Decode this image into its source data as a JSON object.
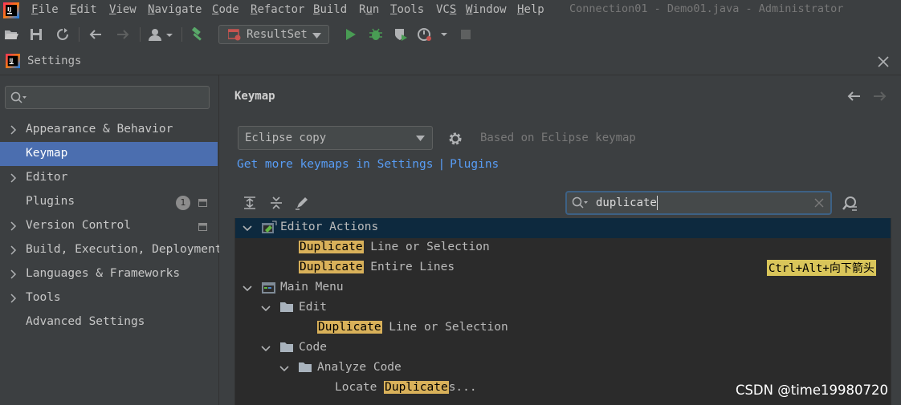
{
  "menubar": {
    "items": [
      {
        "label": "File",
        "mnemonic": "F",
        "rest": "ile"
      },
      {
        "label": "Edit",
        "mnemonic": "E",
        "rest": "dit"
      },
      {
        "label": "View",
        "mnemonic": "V",
        "rest": "iew"
      },
      {
        "label": "Navigate",
        "mnemonic": "N",
        "rest": "avigate"
      },
      {
        "label": "Code",
        "mnemonic": "C",
        "rest": "ode"
      },
      {
        "label": "Refactor",
        "mnemonic": "R",
        "rest": "efactor"
      },
      {
        "label": "Build",
        "mnemonic": "B",
        "rest": "uild"
      },
      {
        "label": "Run",
        "mnemonic": "R",
        "rest": "un",
        "underline_index": 1
      },
      {
        "label": "Tools",
        "mnemonic": "T",
        "rest": "ools"
      },
      {
        "label": "VCS",
        "mnemonic": "S",
        "rest": "VC",
        "underline_index": 2
      },
      {
        "label": "Window",
        "mnemonic": "W",
        "rest": "indow"
      },
      {
        "label": "Help",
        "mnemonic": "H",
        "rest": "elp"
      }
    ],
    "window_title": "Connection01 - Demo01.java - Administrator"
  },
  "toolbar": {
    "run_config": "ResultSet",
    "icons": [
      "open-icon",
      "save-icon",
      "sync-icon",
      "back-icon",
      "forward-icon",
      "user-icon",
      "build-hammer-icon",
      "run-icon",
      "debug-icon",
      "coverage-icon",
      "profile-icon",
      "stop-icon"
    ]
  },
  "dialog": {
    "title": "Settings",
    "sidebar": {
      "search_placeholder": "",
      "items": [
        {
          "label": "Appearance & Behavior",
          "expandable": true,
          "selected": false
        },
        {
          "label": "Keymap",
          "expandable": false,
          "selected": true
        },
        {
          "label": "Editor",
          "expandable": true,
          "selected": false
        },
        {
          "label": "Plugins",
          "expandable": false,
          "selected": false,
          "badge": "1"
        },
        {
          "label": "Version Control",
          "expandable": true,
          "selected": false
        },
        {
          "label": "Build, Execution, Deployment",
          "expandable": true,
          "selected": false
        },
        {
          "label": "Languages & Frameworks",
          "expandable": true,
          "selected": false
        },
        {
          "label": "Tools",
          "expandable": true,
          "selected": false
        },
        {
          "label": "Advanced Settings",
          "expandable": false,
          "selected": false
        }
      ]
    },
    "main": {
      "title": "Keymap",
      "keymap_selected": "Eclipse copy",
      "based_on": "Based on Eclipse keymap",
      "link_get_more": "Get more keymaps in Settings",
      "link_separator": "|",
      "link_plugins": "Plugins",
      "search_value": "duplicate",
      "tree": [
        {
          "depth": 0,
          "expanded": true,
          "icon": "editor-actions-icon",
          "text": "Editor Actions",
          "selected": true
        },
        {
          "depth": 2,
          "hl": "Duplicate",
          "text": " Line or Selection"
        },
        {
          "depth": 2,
          "hl": "Duplicate",
          "text": " Entire Lines",
          "shortcut": "Ctrl+Alt+向下箭头"
        },
        {
          "depth": 0,
          "expanded": true,
          "icon": "main-menu-icon",
          "text": "Main Menu"
        },
        {
          "depth": 1,
          "expanded": true,
          "icon": "folder-icon",
          "text": "Edit"
        },
        {
          "depth": 3,
          "hl": "Duplicate",
          "text": " Line or Selection"
        },
        {
          "depth": 1,
          "expanded": true,
          "icon": "folder-icon",
          "text": "Code"
        },
        {
          "depth": 2,
          "expanded": true,
          "icon": "folder-icon",
          "text": "Analyze Code"
        },
        {
          "depth": 4,
          "prefix": "Locate ",
          "hl": "Duplicate",
          "text": "s..."
        }
      ]
    }
  },
  "watermark": "CSDN @time19980720",
  "colors": {
    "background": "#2b2b2b",
    "panel": "#3c3f41",
    "selection": "#4b6eaf",
    "link": "#589df6",
    "highlight": "#d9b15a"
  }
}
